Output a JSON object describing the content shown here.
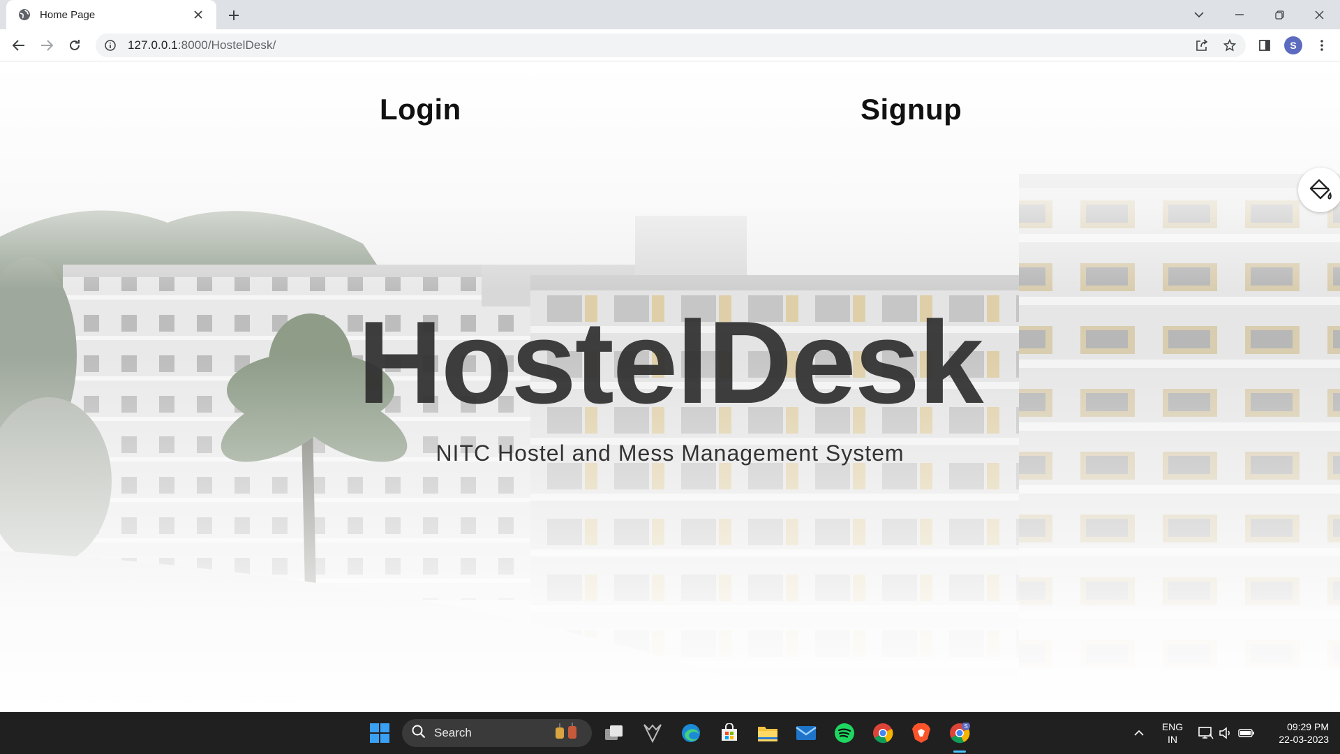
{
  "browser": {
    "tab": {
      "title": "Home Page",
      "favicon": "globe-icon"
    },
    "address": {
      "host": "127.0.0.1",
      "path": ":8000/HostelDesk/"
    },
    "profile_initial": "S"
  },
  "page": {
    "nav": {
      "login": "Login",
      "signup": "Signup"
    },
    "brand": "HostelDesk",
    "tagline": "NITC Hostel and Mess Management System",
    "theme_button_icon": "paint-bucket-icon"
  },
  "taskbar": {
    "search_label": "Search",
    "apps": [
      "windows-start-icon",
      "task-view-icon",
      "acer-app-icon",
      "edge-icon",
      "store-icon",
      "file-explorer-icon",
      "mail-icon",
      "spotify-icon",
      "chrome-icon",
      "brave-icon",
      "chrome-profile-icon"
    ],
    "chrome_badge": "S",
    "language": {
      "line1": "ENG",
      "line2": "IN"
    },
    "clock": {
      "time": "09:29 PM",
      "date": "22-03-2023"
    }
  },
  "colors": {
    "accent": "#4cc2ff",
    "brand_text": "#2f2f2f",
    "taskbar": "#202020"
  }
}
